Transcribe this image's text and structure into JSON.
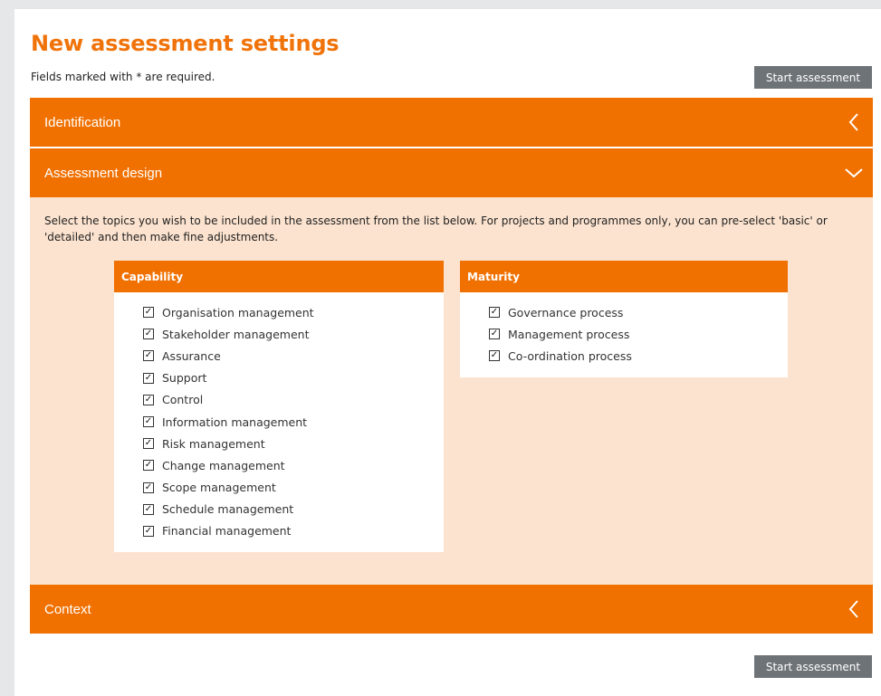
{
  "page": {
    "title": "New assessment settings",
    "required_note": "Fields marked with * are required.",
    "start_button_label": "Start assessment"
  },
  "sections": {
    "identification": {
      "label": "Identification",
      "state": "collapsed",
      "chevron_icon": "chevron-left-icon"
    },
    "assessment_design": {
      "label": "Assessment design",
      "state": "expanded",
      "chevron_icon": "chevron-down-icon"
    },
    "context": {
      "label": "Context",
      "state": "collapsed",
      "chevron_icon": "chevron-left-icon"
    }
  },
  "design": {
    "intro_text": "Select the topics you wish to be included in the assessment from the list below. For projects and programmes only, you can pre-select 'basic' or 'detailed' and then make fine adjustments.",
    "capability": {
      "header": "Capability",
      "items": [
        {
          "label": "Organisation management",
          "checked": true
        },
        {
          "label": "Stakeholder management",
          "checked": true
        },
        {
          "label": "Assurance",
          "checked": true
        },
        {
          "label": "Support",
          "checked": true
        },
        {
          "label": "Control",
          "checked": true
        },
        {
          "label": "Information management",
          "checked": true
        },
        {
          "label": "Risk management",
          "checked": true
        },
        {
          "label": "Change management",
          "checked": true
        },
        {
          "label": "Scope management",
          "checked": true
        },
        {
          "label": "Schedule management",
          "checked": true
        },
        {
          "label": "Financial management",
          "checked": true
        }
      ]
    },
    "maturity": {
      "header": "Maturity",
      "items": [
        {
          "label": "Governance process",
          "checked": true
        },
        {
          "label": "Management process",
          "checked": true
        },
        {
          "label": "Co-ordination process",
          "checked": true
        }
      ]
    }
  },
  "colors": {
    "accent_orange": "#f07000",
    "panel_bg_peach": "#fce3cf",
    "button_gray": "#6e7378",
    "page_bg": "#e6e7e9"
  }
}
